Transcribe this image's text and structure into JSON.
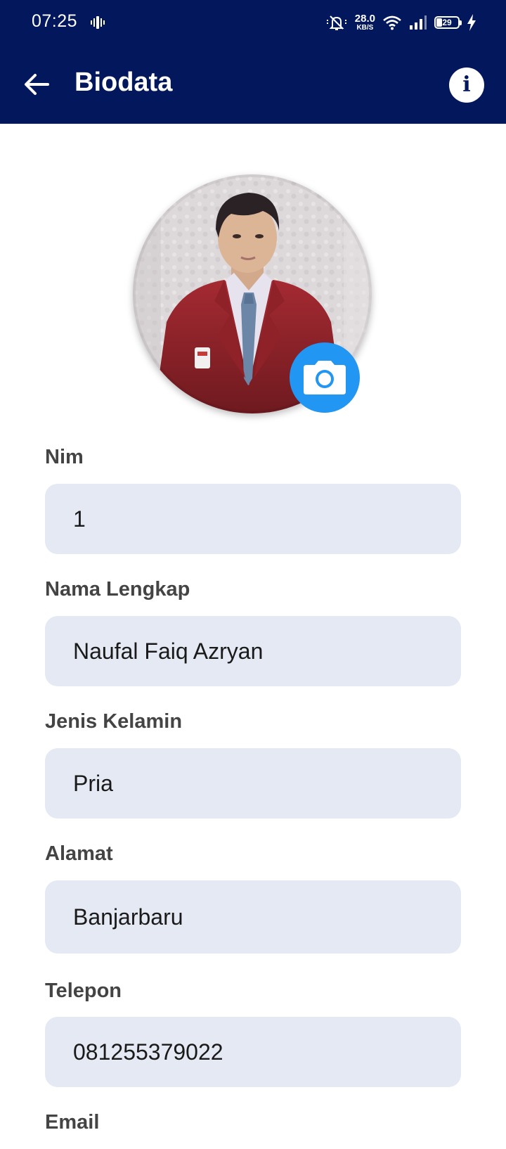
{
  "status_bar": {
    "time": "07:25",
    "net_speed_value": "28.0",
    "net_speed_unit": "KB/S",
    "battery_level": "29",
    "icons": [
      "vibration-icon",
      "mute-icon",
      "wifi-icon",
      "signal-icon",
      "battery-icon",
      "charging-icon"
    ]
  },
  "appbar": {
    "title": "Biodata",
    "back_icon": "arrow-left-icon",
    "info_icon": "info-icon"
  },
  "profile": {
    "photo_alt": "Profile photo",
    "camera_icon": "camera-icon"
  },
  "form": {
    "nim_label": "Nim",
    "nim_value": "1",
    "name_label": "Nama Lengkap",
    "name_value": "Naufal Faiq Azryan",
    "gender_label": "Jenis Kelamin",
    "gender_value": "Pria",
    "address_label": "Alamat",
    "address_value": "Banjarbaru",
    "phone_label": "Telepon",
    "phone_value": "081255379022",
    "email_label": "Email"
  },
  "colors": {
    "header_bg": "#03185c",
    "accent": "#2196f3",
    "field_bg": "#e4e9f3",
    "label": "#444444"
  }
}
